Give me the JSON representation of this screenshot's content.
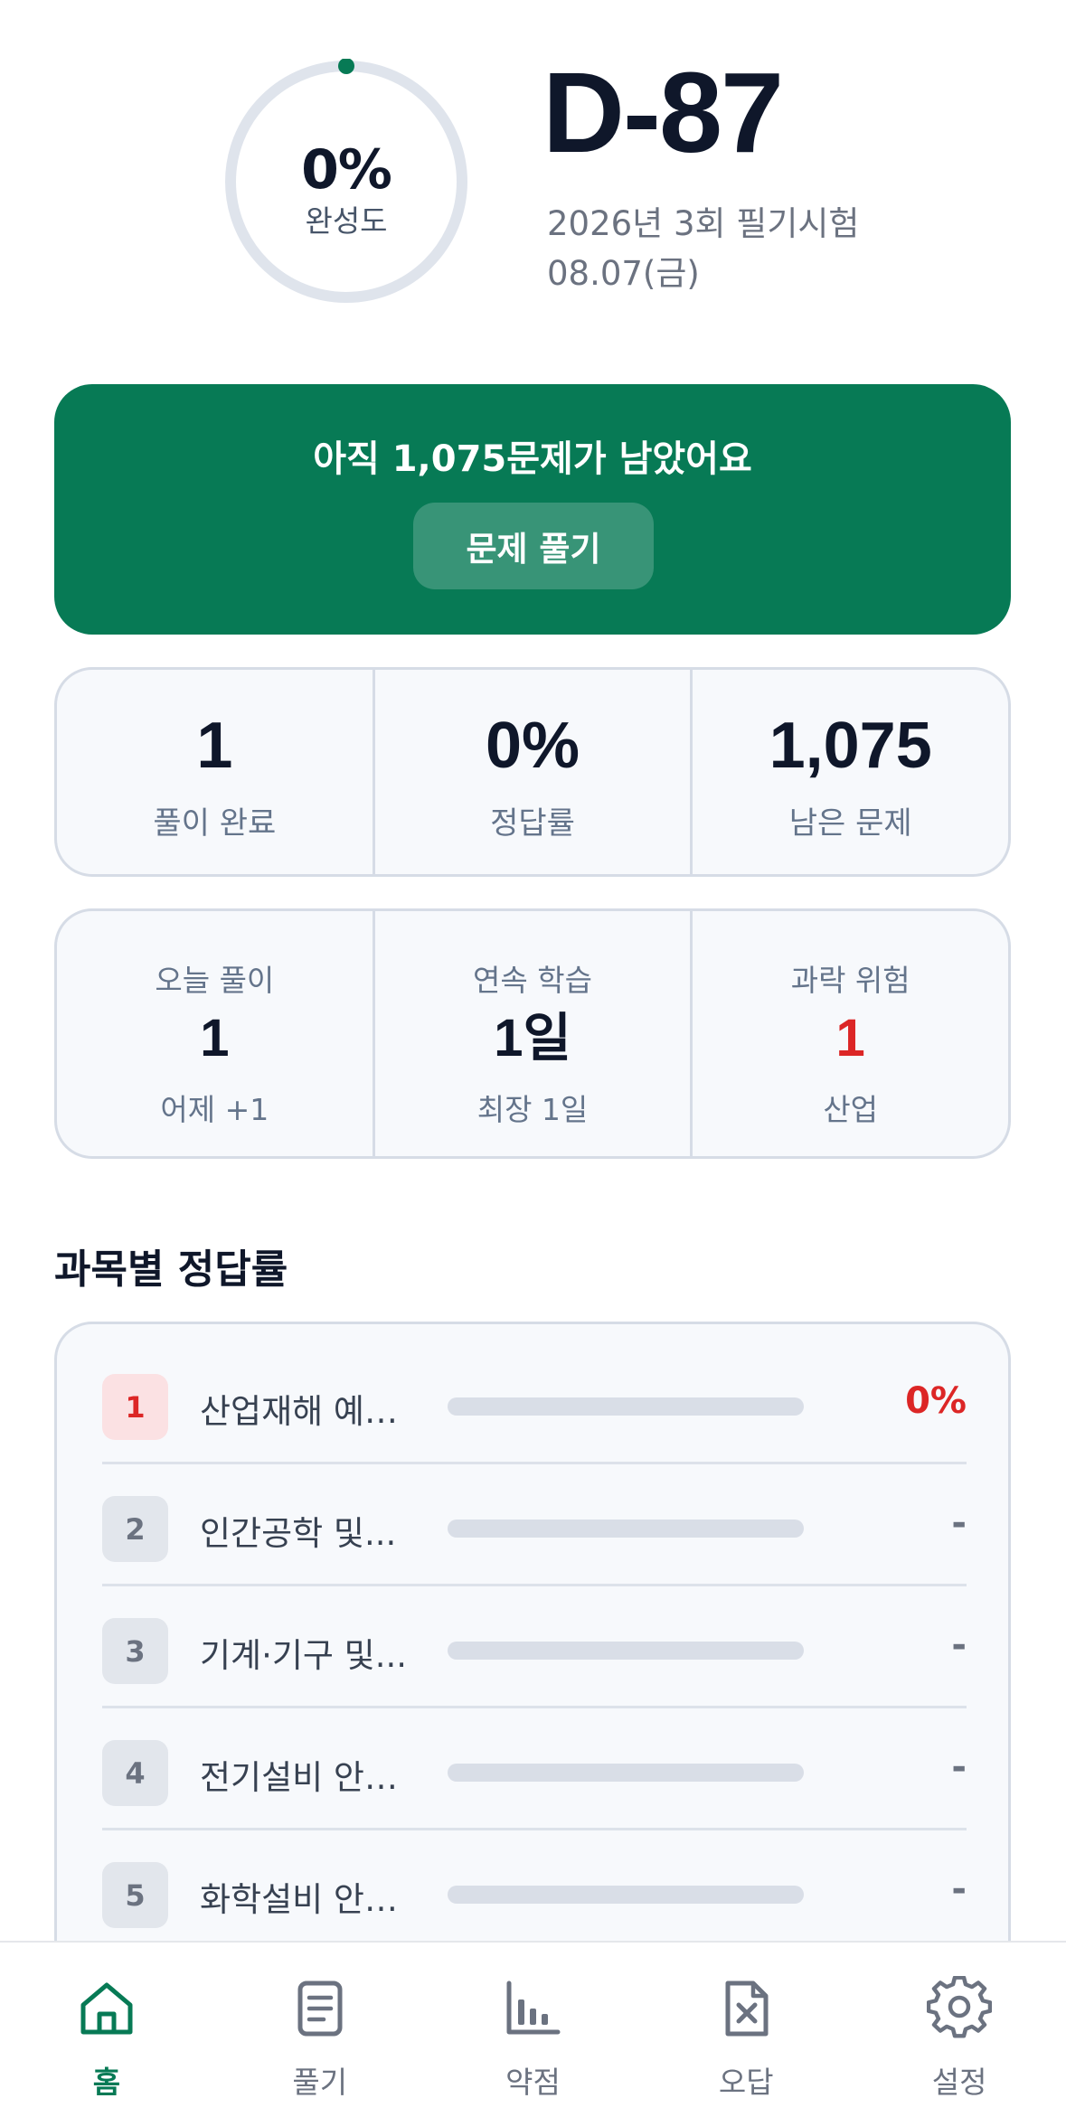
{
  "header": {
    "progress_percent_text": "0%",
    "progress_label": "완성도",
    "progress_value": 0,
    "dday": "D-87",
    "exam_name": "2026년 3회 필기시험",
    "exam_date": "08.07(금)"
  },
  "banner": {
    "message": "아직 1,075문제가 남았어요",
    "button_label": "문제 풀기"
  },
  "stats": [
    {
      "value": "1",
      "label": "풀이 완료"
    },
    {
      "value": "0%",
      "label": "정답률"
    },
    {
      "value": "1,075",
      "label": "남은 문제"
    }
  ],
  "daily": [
    {
      "title": "오늘 풀이",
      "value": "1",
      "sub": "어제 +1"
    },
    {
      "title": "연속 학습",
      "value": "1일",
      "sub": "최장 1일"
    },
    {
      "title": "과락 위험",
      "value": "1",
      "sub": "산업"
    }
  ],
  "subjects": {
    "title": "과목별 정답률",
    "items": [
      {
        "num": "1",
        "name": "산업재해 예…",
        "value": "0%",
        "progress": 0
      },
      {
        "num": "2",
        "name": "인간공학 및...",
        "value": "-",
        "progress": 0
      },
      {
        "num": "3",
        "name": "기계·기구 및...",
        "value": "-",
        "progress": 0
      },
      {
        "num": "4",
        "name": "전기설비 안…",
        "value": "-",
        "progress": 0
      },
      {
        "num": "5",
        "name": "화학설비 안…",
        "value": "-",
        "progress": 0
      }
    ]
  },
  "nav": [
    {
      "label": "홈",
      "icon": "home-icon",
      "active": true
    },
    {
      "label": "풀기",
      "icon": "document-icon",
      "active": false
    },
    {
      "label": "약점",
      "icon": "bar-chart-icon",
      "active": false
    },
    {
      "label": "오답",
      "icon": "wrong-answer-file-icon",
      "active": false
    },
    {
      "label": "설정",
      "icon": "gear-icon",
      "active": false
    }
  ],
  "colors": {
    "accent": "#077a55",
    "danger": "#dc2626",
    "card_bg": "#f7f9fc",
    "border": "#d6dce6"
  }
}
